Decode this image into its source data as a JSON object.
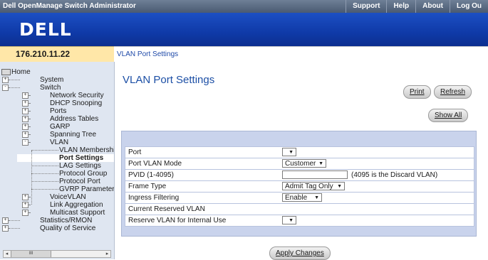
{
  "topbar": {
    "title": "Dell OpenManage Switch Administrator",
    "links": [
      "Support",
      "Help",
      "About",
      "Log Ou"
    ]
  },
  "branding": {
    "logo_text": "DELL"
  },
  "header": {
    "ip": "176.210.11.22",
    "breadcrumb": "VLAN Port Settings"
  },
  "sidebar": {
    "items": [
      {
        "label": "Home",
        "level": 0,
        "icon": "folder-icon"
      },
      {
        "label": "System",
        "level": 1,
        "expander": "+"
      },
      {
        "label": "Switch",
        "level": 1,
        "expander": "-"
      },
      {
        "label": "Network Security",
        "level": 2,
        "expander": "+"
      },
      {
        "label": "DHCP Snooping",
        "level": 2,
        "expander": "+"
      },
      {
        "label": "Ports",
        "level": 2,
        "expander": "+"
      },
      {
        "label": "Address Tables",
        "level": 2,
        "expander": "+"
      },
      {
        "label": "GARP",
        "level": 2,
        "expander": "+"
      },
      {
        "label": "Spanning Tree",
        "level": 2,
        "expander": "+"
      },
      {
        "label": "VLAN",
        "level": 2,
        "expander": "-"
      },
      {
        "label": "VLAN Membershi",
        "level": 3
      },
      {
        "label": "Port Settings",
        "level": 3,
        "selected": true
      },
      {
        "label": "LAG Settings",
        "level": 3
      },
      {
        "label": "Protocol Group",
        "level": 3
      },
      {
        "label": "Protocol Port",
        "level": 3
      },
      {
        "label": "GVRP Parameter",
        "level": 3
      },
      {
        "label": "VoiceVLAN",
        "level": 2,
        "expander": "+"
      },
      {
        "label": "Link Aggregation",
        "level": 2,
        "expander": "+"
      },
      {
        "label": "Multicast Support",
        "level": 2,
        "expander": "+"
      },
      {
        "label": "Statistics/RMON",
        "level": 1,
        "expander": "+"
      },
      {
        "label": "Quality of Service",
        "level": 1,
        "expander": "+"
      }
    ],
    "scroll_thumb_glyph": "III"
  },
  "main": {
    "title": "VLAN Port Settings",
    "buttons": {
      "print": "Print",
      "refresh": "Refresh",
      "show_all": "Show All",
      "apply": "Apply Changes"
    },
    "rows": [
      {
        "label": "Port",
        "control": "select",
        "value": ""
      },
      {
        "label": "Port VLAN Mode",
        "control": "select",
        "value": "Customer"
      },
      {
        "label": "PVID (1-4095)",
        "control": "text",
        "value": "",
        "hint": "(4095 is the Discard VLAN)"
      },
      {
        "label": "Frame Type",
        "control": "select",
        "value": "Admit Tag Only"
      },
      {
        "label": "Ingress Filtering",
        "control": "select",
        "value": "Enable"
      },
      {
        "label": "Current Reserved VLAN",
        "control": "none",
        "value": ""
      },
      {
        "label": "Reserve VLAN for Internal Use",
        "control": "select",
        "value": ""
      }
    ]
  },
  "colors": {
    "topbar": "#4a5a72",
    "brand_band": "#1646b8",
    "ip_bar": "#ffe7a8",
    "panel": "#c9d3ec",
    "title_blue": "#1c4fa5"
  }
}
